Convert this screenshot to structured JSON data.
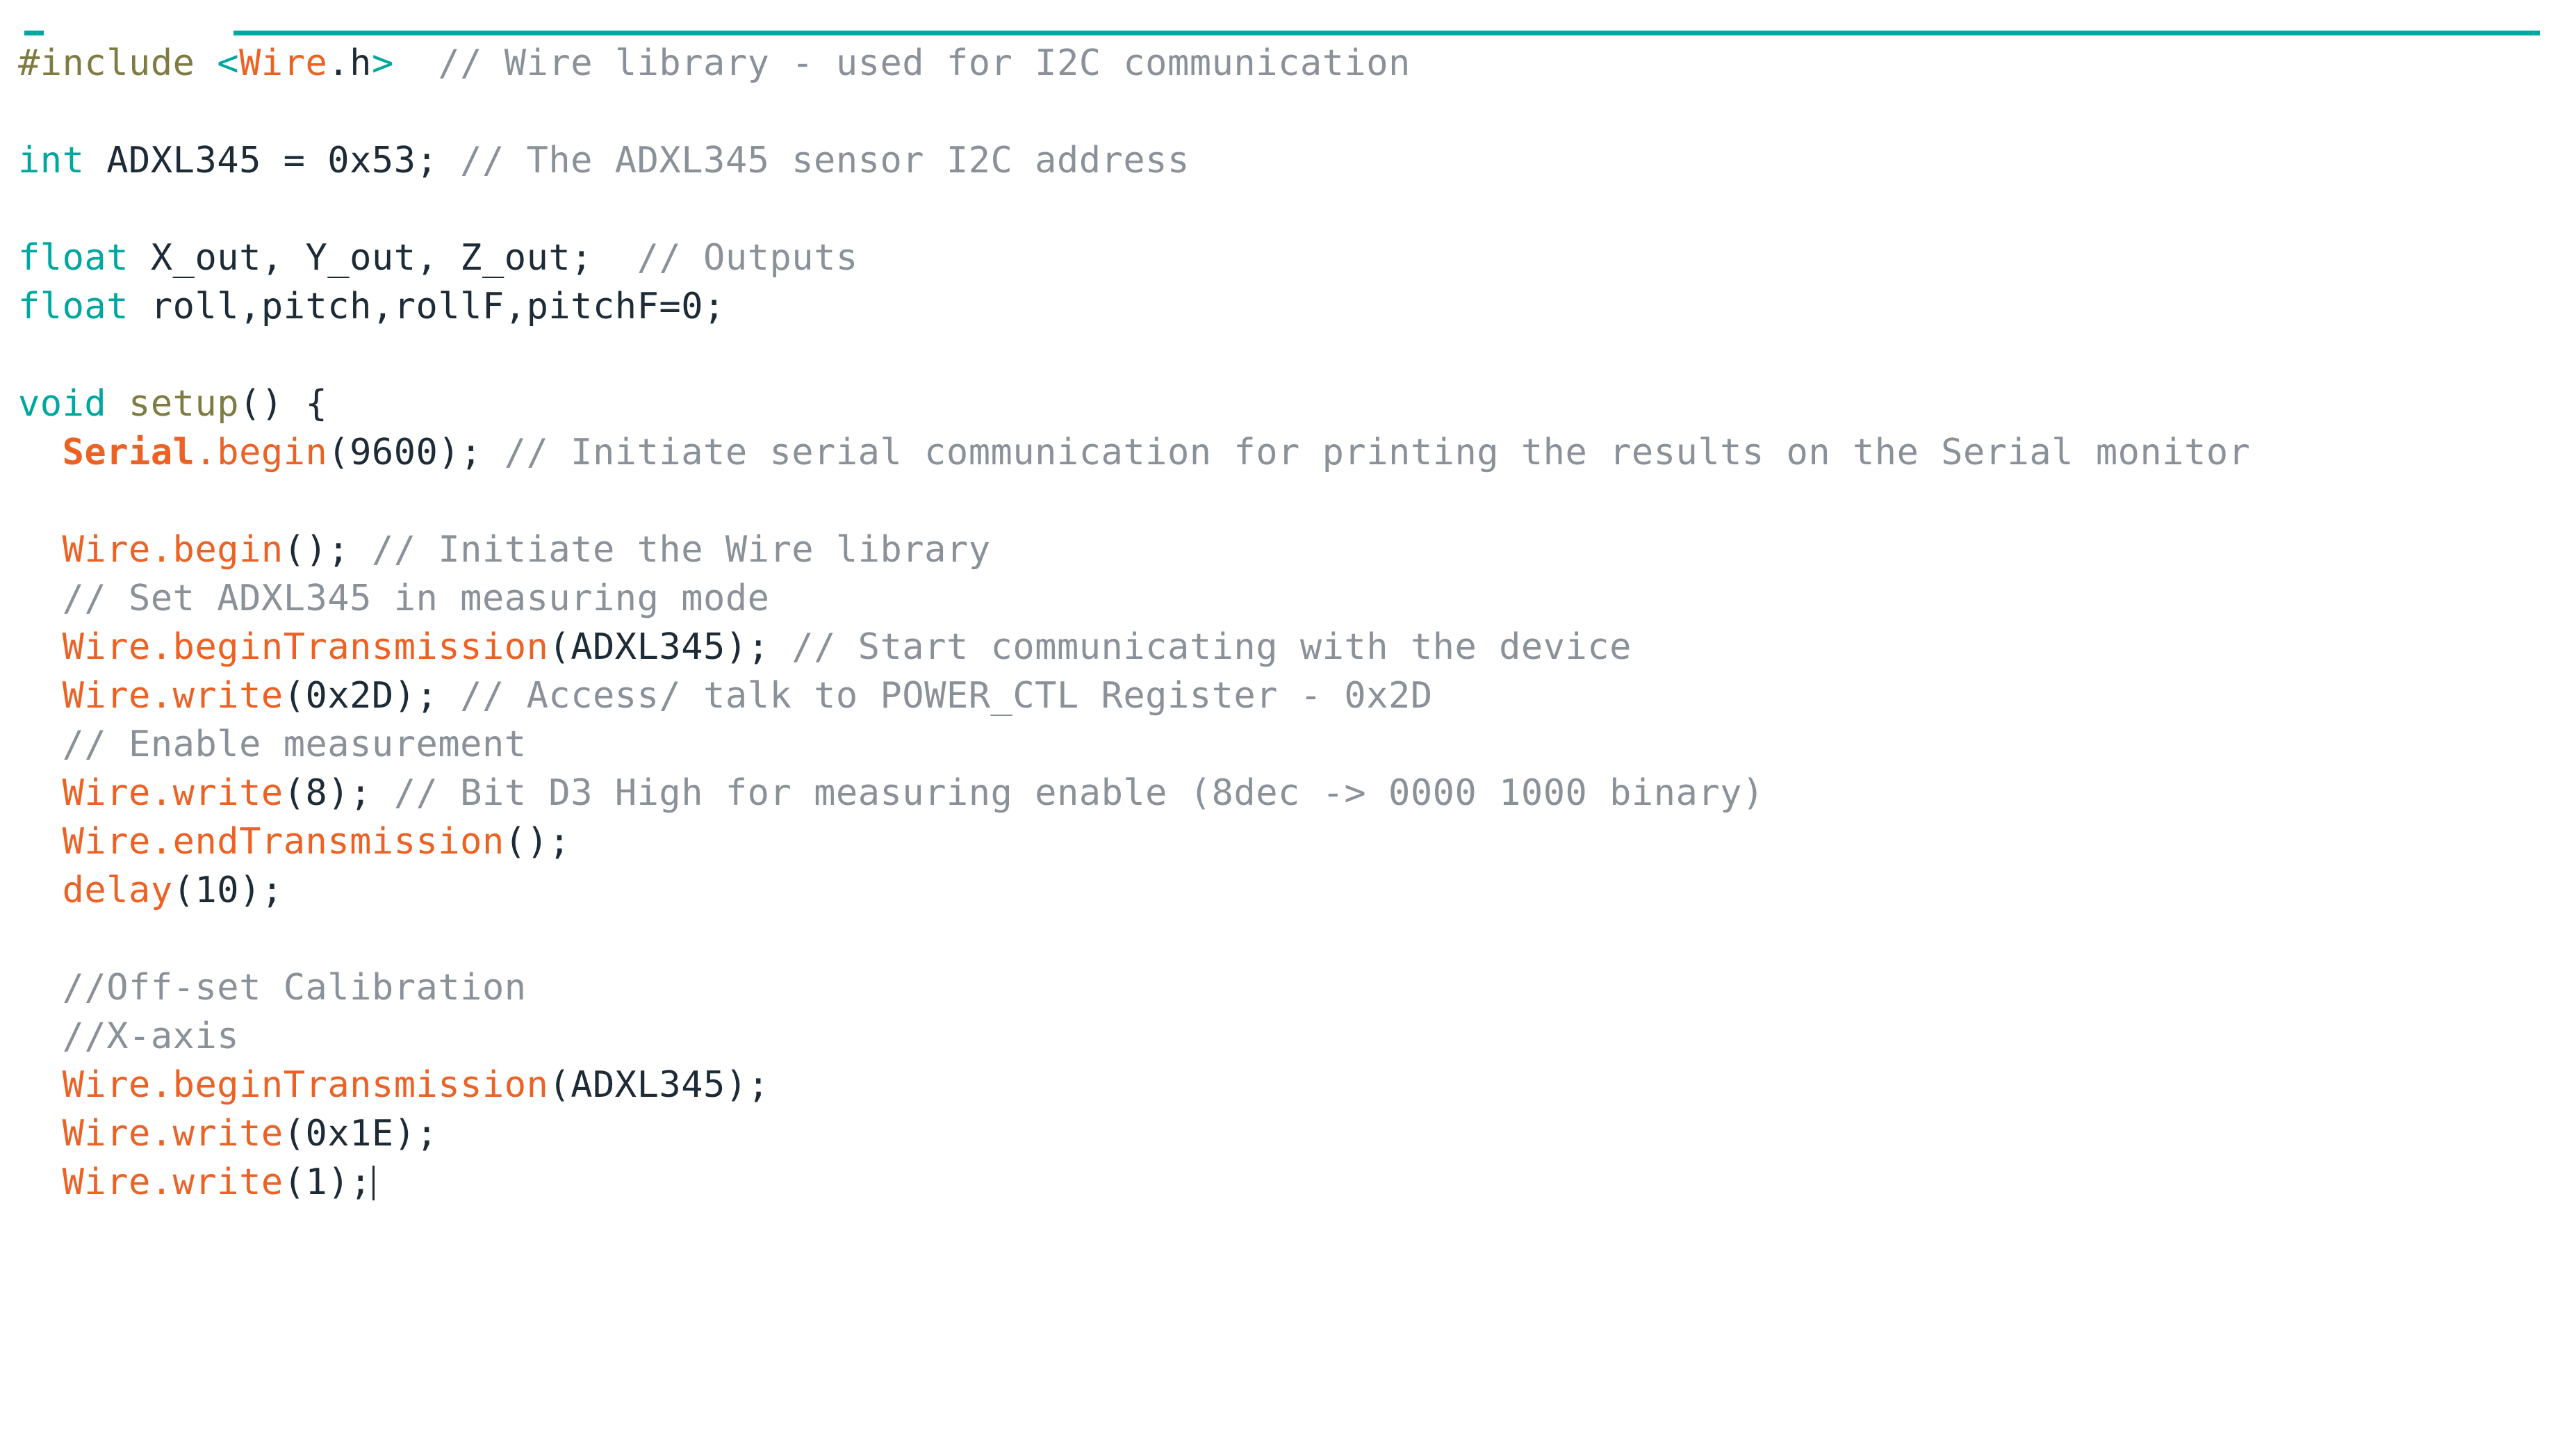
{
  "app": {
    "title": "Arduino IDE code editor",
    "accent_color": "#00a7a0",
    "background_color": "#ffffff",
    "keyword_color": "#00a7a0",
    "library_color": "#ec6225",
    "comment_color": "#8a9199",
    "preprocessor_color": "#7e7c42",
    "text_color": "#1d2b36"
  },
  "tab_strip": {
    "tab_marker": "",
    "underline": ""
  },
  "code": {
    "lines": [
      {
        "id": "line-include",
        "tokens": [
          {
            "cls": "tk-pre",
            "text": "#include "
          },
          {
            "cls": "tk-ang",
            "text": "<"
          },
          {
            "cls": "tk-lib",
            "text": "Wire"
          },
          {
            "cls": "tk-punct",
            "text": ".h"
          },
          {
            "cls": "tk-ang",
            "text": ">"
          },
          {
            "cls": "tk-com",
            "text": "  // Wire library - used for I2C communication"
          }
        ]
      },
      {
        "id": "line-blank-1",
        "tokens": []
      },
      {
        "id": "line-adxl-address",
        "tokens": [
          {
            "cls": "tk-type",
            "text": "int"
          },
          {
            "cls": "tk-punct",
            "text": " ADXL345 = 0x53; "
          },
          {
            "cls": "tk-com",
            "text": "// The ADXL345 sensor I2C address"
          }
        ]
      },
      {
        "id": "line-blank-2",
        "tokens": []
      },
      {
        "id": "line-float-outputs",
        "tokens": [
          {
            "cls": "tk-type",
            "text": "float"
          },
          {
            "cls": "tk-punct",
            "text": " X_out, Y_out, Z_out;  "
          },
          {
            "cls": "tk-com",
            "text": "// Outputs"
          }
        ]
      },
      {
        "id": "line-float-roll-pitch",
        "tokens": [
          {
            "cls": "tk-type",
            "text": "float"
          },
          {
            "cls": "tk-punct",
            "text": " roll,pitch,rollF,pitchF=0;"
          }
        ]
      },
      {
        "id": "line-blank-3",
        "tokens": []
      },
      {
        "id": "line-setup-open",
        "tokens": [
          {
            "cls": "tk-type",
            "text": "void"
          },
          {
            "cls": "tk-punct",
            "text": " "
          },
          {
            "cls": "tk-fn",
            "text": "setup"
          },
          {
            "cls": "tk-punct",
            "text": "() {"
          }
        ]
      },
      {
        "id": "line-serial-begin",
        "indent": 1,
        "tokens": [
          {
            "cls": "tk-libb",
            "text": "Serial"
          },
          {
            "cls": "tk-lib",
            "text": ".begin"
          },
          {
            "cls": "tk-punct",
            "text": "(9600); "
          },
          {
            "cls": "tk-com",
            "text": "// Initiate serial communication for printing the results on the Serial monitor"
          }
        ]
      },
      {
        "id": "line-blank-4",
        "tokens": []
      },
      {
        "id": "line-wire-begin",
        "indent": 1,
        "tokens": [
          {
            "cls": "tk-lib",
            "text": "Wire"
          },
          {
            "cls": "tk-lib",
            "text": ".begin"
          },
          {
            "cls": "tk-punct",
            "text": "(); "
          },
          {
            "cls": "tk-com",
            "text": "// Initiate the Wire library"
          }
        ]
      },
      {
        "id": "line-comment-measuring-mode",
        "indent": 1,
        "tokens": [
          {
            "cls": "tk-com",
            "text": "// Set ADXL345 in measuring mode"
          }
        ]
      },
      {
        "id": "line-begin-transmission-1",
        "indent": 1,
        "tokens": [
          {
            "cls": "tk-lib",
            "text": "Wire"
          },
          {
            "cls": "tk-lib",
            "text": ".beginTransmission"
          },
          {
            "cls": "tk-punct",
            "text": "(ADXL345); "
          },
          {
            "cls": "tk-com",
            "text": "// Start communicating with the device"
          }
        ]
      },
      {
        "id": "line-write-power-ctl",
        "indent": 1,
        "tokens": [
          {
            "cls": "tk-lib",
            "text": "Wire"
          },
          {
            "cls": "tk-lib",
            "text": ".write"
          },
          {
            "cls": "tk-punct",
            "text": "(0x2D); "
          },
          {
            "cls": "tk-com",
            "text": "// Access/ talk to POWER_CTL Register - 0x2D"
          }
        ]
      },
      {
        "id": "line-comment-enable-measurement",
        "indent": 1,
        "tokens": [
          {
            "cls": "tk-com",
            "text": "// Enable measurement"
          }
        ]
      },
      {
        "id": "line-write-8",
        "indent": 1,
        "tokens": [
          {
            "cls": "tk-lib",
            "text": "Wire"
          },
          {
            "cls": "tk-lib",
            "text": ".write"
          },
          {
            "cls": "tk-punct",
            "text": "(8); "
          },
          {
            "cls": "tk-com",
            "text": "// Bit D3 High for measuring enable (8dec -> 0000 1000 binary)"
          }
        ]
      },
      {
        "id": "line-end-transmission",
        "indent": 1,
        "tokens": [
          {
            "cls": "tk-lib",
            "text": "Wire"
          },
          {
            "cls": "tk-lib",
            "text": ".endTransmission"
          },
          {
            "cls": "tk-punct",
            "text": "();"
          }
        ]
      },
      {
        "id": "line-delay-10",
        "indent": 1,
        "tokens": [
          {
            "cls": "tk-lib",
            "text": "delay"
          },
          {
            "cls": "tk-punct",
            "text": "(10);"
          }
        ]
      },
      {
        "id": "line-blank-5",
        "tokens": []
      },
      {
        "id": "line-comment-offset-calibration",
        "indent": 1,
        "tokens": [
          {
            "cls": "tk-com",
            "text": "//Off-set Calibration"
          }
        ]
      },
      {
        "id": "line-comment-x-axis",
        "indent": 1,
        "tokens": [
          {
            "cls": "tk-com",
            "text": "//X-axis"
          }
        ]
      },
      {
        "id": "line-begin-transmission-2",
        "indent": 1,
        "tokens": [
          {
            "cls": "tk-lib",
            "text": "Wire"
          },
          {
            "cls": "tk-lib",
            "text": ".beginTransmission"
          },
          {
            "cls": "tk-punct",
            "text": "(ADXL345);"
          }
        ]
      },
      {
        "id": "line-write-0x1e",
        "indent": 1,
        "tokens": [
          {
            "cls": "tk-lib",
            "text": "Wire"
          },
          {
            "cls": "tk-lib",
            "text": ".write"
          },
          {
            "cls": "tk-punct",
            "text": "(0x1E);"
          }
        ]
      },
      {
        "id": "line-write-1",
        "indent": 1,
        "caret": true,
        "tokens": [
          {
            "cls": "tk-lib",
            "text": "Wire"
          },
          {
            "cls": "tk-lib",
            "text": ".write"
          },
          {
            "cls": "tk-punct",
            "text": "(1);"
          }
        ]
      }
    ]
  }
}
